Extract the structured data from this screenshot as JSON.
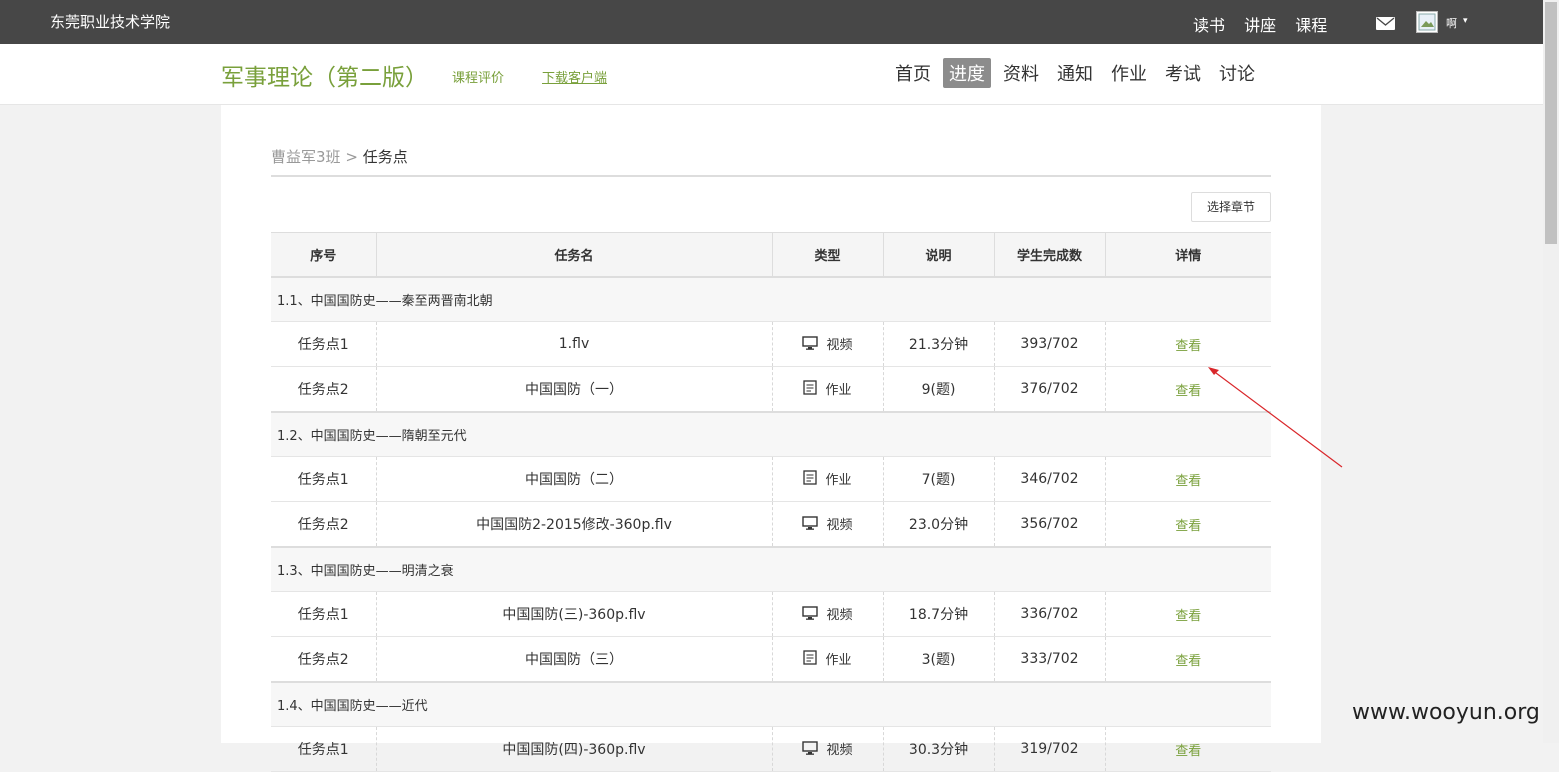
{
  "topbar": {
    "school": "东莞职业技术学院",
    "links": [
      "读书",
      "讲座",
      "课程"
    ],
    "username": "啊"
  },
  "header": {
    "course_title": "军事理论（第二版）",
    "eval_link": "课程评价",
    "download_link": "下载客户端",
    "nav": [
      {
        "label": "首页",
        "active": false
      },
      {
        "label": "进度",
        "active": true
      },
      {
        "label": "资料",
        "active": false
      },
      {
        "label": "通知",
        "active": false
      },
      {
        "label": "作业",
        "active": false
      },
      {
        "label": "考试",
        "active": false
      },
      {
        "label": "讨论",
        "active": false
      }
    ]
  },
  "breadcrumb": {
    "parent": "曹益军3班",
    "sep": ">",
    "current": "任务点"
  },
  "select_chapter": "选择章节",
  "table": {
    "headers": [
      "序号",
      "任务名",
      "类型",
      "说明",
      "学生完成数",
      "详情"
    ],
    "view_label": "查看",
    "type_labels": {
      "video": "视频",
      "homework": "作业"
    },
    "sections": [
      {
        "title": "1.1、中国国防史——秦至两晋南北朝",
        "rows": [
          {
            "seq": "任务点1",
            "name": "1.flv",
            "type": "video",
            "desc": "21.3分钟",
            "done": "393/702"
          },
          {
            "seq": "任务点2",
            "name": "中国国防（一）",
            "type": "homework",
            "desc": "9(题)",
            "done": "376/702"
          }
        ]
      },
      {
        "title": "1.2、中国国防史——隋朝至元代",
        "rows": [
          {
            "seq": "任务点1",
            "name": "中国国防（二）",
            "type": "homework",
            "desc": "7(题)",
            "done": "346/702"
          },
          {
            "seq": "任务点2",
            "name": "中国国防2-2015修改-360p.flv",
            "type": "video",
            "desc": "23.0分钟",
            "done": "356/702"
          }
        ]
      },
      {
        "title": "1.3、中国国防史——明清之衰",
        "rows": [
          {
            "seq": "任务点1",
            "name": "中国国防(三)-360p.flv",
            "type": "video",
            "desc": "18.7分钟",
            "done": "336/702"
          },
          {
            "seq": "任务点2",
            "name": "中国国防（三）",
            "type": "homework",
            "desc": "3(题)",
            "done": "333/702"
          }
        ]
      },
      {
        "title": "1.4、中国国防史——近代",
        "rows": [
          {
            "seq": "任务点1",
            "name": "中国国防(四)-360p.flv",
            "type": "video",
            "desc": "30.3分钟",
            "done": "319/702"
          }
        ]
      }
    ]
  },
  "watermark": "www.wooyun.org",
  "colors": {
    "accent": "#79a03b",
    "topbar": "#474747",
    "annotation_arrow": "#d9262a"
  }
}
